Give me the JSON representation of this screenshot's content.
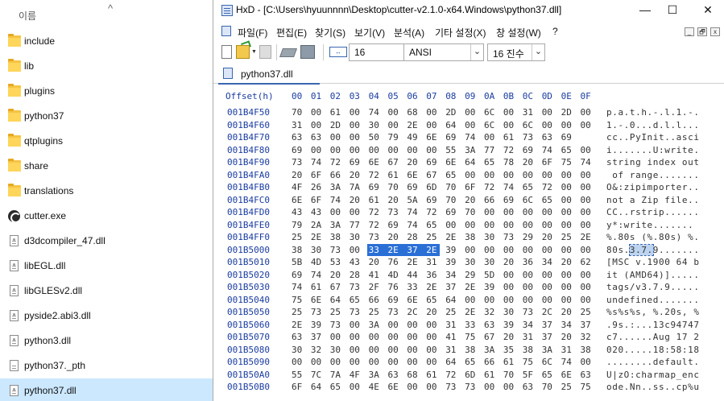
{
  "explorer": {
    "column_name": "이름",
    "items": [
      {
        "name": "include",
        "type": "folder"
      },
      {
        "name": "lib",
        "type": "folder"
      },
      {
        "name": "plugins",
        "type": "folder"
      },
      {
        "name": "python37",
        "type": "folder"
      },
      {
        "name": "qtplugins",
        "type": "folder"
      },
      {
        "name": "share",
        "type": "folder"
      },
      {
        "name": "translations",
        "type": "folder"
      },
      {
        "name": "cutter.exe",
        "type": "exe"
      },
      {
        "name": "d3dcompiler_47.dll",
        "type": "dll"
      },
      {
        "name": "libEGL.dll",
        "type": "dll"
      },
      {
        "name": "libGLESv2.dll",
        "type": "dll"
      },
      {
        "name": "pyside2.abi3.dll",
        "type": "dll"
      },
      {
        "name": "python3.dll",
        "type": "dll"
      },
      {
        "name": "python37._pth",
        "type": "file"
      },
      {
        "name": "python37.dll",
        "type": "dll",
        "selected": true
      }
    ]
  },
  "hxd": {
    "title": "HxD - [C:\\Users\\hyuunnnn\\Desktop\\cutter-v2.1.0-x64.Windows\\python37.dll]",
    "window_buttons": [
      "—",
      "☐",
      "✕"
    ],
    "menu": [
      "파일(F)",
      "편집(E)",
      "찾기(S)",
      "보기(V)",
      "분석(A)",
      "기타 설정(X)",
      "창 설정(W)",
      "?"
    ],
    "mdi_buttons": [
      "_",
      "🗗",
      "x"
    ],
    "toolbar": {
      "bytes_per_row": "16",
      "charset": "ANSI",
      "offset_base": "16 진수"
    },
    "tab": "python37.dll",
    "offset_header": "Offset(h)",
    "columns": [
      "00",
      "01",
      "02",
      "03",
      "04",
      "05",
      "06",
      "07",
      "08",
      "09",
      "0A",
      "0B",
      "0C",
      "0D",
      "0E",
      "0F"
    ],
    "rows": [
      {
        "offset": "001B4F50",
        "bytes": "70 00 61 00 74 00 68 00 2D 00 6C 00 31 00 2D 00",
        "text": "p.a.t.h.-.l.1.-."
      },
      {
        "offset": "001B4F60",
        "bytes": "31 00 2D 00 30 00 2E 00 64 00 6C 00 6C 00 00 00",
        "text": "1.-.0...d.l.l..."
      },
      {
        "offset": "001B4F70",
        "bytes": "63 63 00 00 50 79 49 6E 69 74 00 61 73 63 69",
        "text": "cc..PyInit..asci"
      },
      {
        "offset": "001B4F80",
        "bytes": "69 00 00 00 00 00 00 00 55 3A 77 72 69 74 65 00",
        "text": "i.......U:write."
      },
      {
        "offset": "001B4F90",
        "bytes": "73 74 72 69 6E 67 20 69 6E 64 65 78 20 6F 75 74",
        "text": "string index out"
      },
      {
        "offset": "001B4FA0",
        "bytes": "20 6F 66 20 72 61 6E 67 65 00 00 00 00 00 00 00",
        "text": " of range......."
      },
      {
        "offset": "001B4FB0",
        "bytes": "4F 26 3A 7A 69 70 69 6D 70 6F 72 74 65 72 00 00",
        "text": "O&:zipimporter.."
      },
      {
        "offset": "001B4FC0",
        "bytes": "6E 6F 74 20 61 20 5A 69 70 20 66 69 6C 65 00 00",
        "text": "not a Zip file.."
      },
      {
        "offset": "001B4FD0",
        "bytes": "43 43 00 00 72 73 74 72 69 70 00 00 00 00 00 00",
        "text": "CC..rstrip......"
      },
      {
        "offset": "001B4FE0",
        "bytes": "79 2A 3A 77 72 69 74 65 00 00 00 00 00 00 00 00",
        "text": "y*:write......."
      },
      {
        "offset": "001B4FF0",
        "bytes": "25 2E 38 30 73 20 28 25 2E 38 30 73 29 20 25 2E",
        "text": "%.80s (%.80s) %."
      },
      {
        "offset": "001B5000",
        "bytes": "38 30 73 00 33 2E 37 2E 39 00 00 00 00 00 00 00",
        "text": "80s.3.7.9.......",
        "sel_start": 4,
        "sel_end": 7
      },
      {
        "offset": "001B5010",
        "bytes": "5B 4D 53 43 20 76 2E 31 39 30 30 20 36 34 20 62",
        "text": "[MSC v.1900 64 b"
      },
      {
        "offset": "001B5020",
        "bytes": "69 74 20 28 41 4D 44 36 34 29 5D 00 00 00 00 00",
        "text": "it (AMD64)]....."
      },
      {
        "offset": "001B5030",
        "bytes": "74 61 67 73 2F 76 33 2E 37 2E 39 00 00 00 00 00",
        "text": "tags/v3.7.9....."
      },
      {
        "offset": "001B5040",
        "bytes": "75 6E 64 65 66 69 6E 65 64 00 00 00 00 00 00 00",
        "text": "undefined......."
      },
      {
        "offset": "001B5050",
        "bytes": "25 73 25 73 25 73 2C 20 25 2E 32 30 73 2C 20 25",
        "text": "%s%s%s, %.20s, %"
      },
      {
        "offset": "001B5060",
        "bytes": "2E 39 73 00 3A 00 00 00 31 33 63 39 34 37 34 37",
        "text": ".9s.:...13c94747"
      },
      {
        "offset": "001B5070",
        "bytes": "63 37 00 00 00 00 00 00 41 75 67 20 31 37 20 32",
        "text": "c7......Aug 17 2"
      },
      {
        "offset": "001B5080",
        "bytes": "30 32 30 00 00 00 00 00 31 38 3A 35 38 3A 31 38",
        "text": "020.....18:58:18"
      },
      {
        "offset": "001B5090",
        "bytes": "00 00 00 00 00 00 00 00 64 65 66 61 75 6C 74 00",
        "text": "........default."
      },
      {
        "offset": "001B50A0",
        "bytes": "55 7C 7A 4F 3A 63 68 61 72 6D 61 70 5F 65 6E 63",
        "text": "U|zO:charmap_enc"
      },
      {
        "offset": "001B50B0",
        "bytes": "6F 64 65 00 4E 6E 00 00 73 73 00 00 63 70 25 75",
        "text": "ode.Nn..ss..cp%u"
      }
    ]
  }
}
